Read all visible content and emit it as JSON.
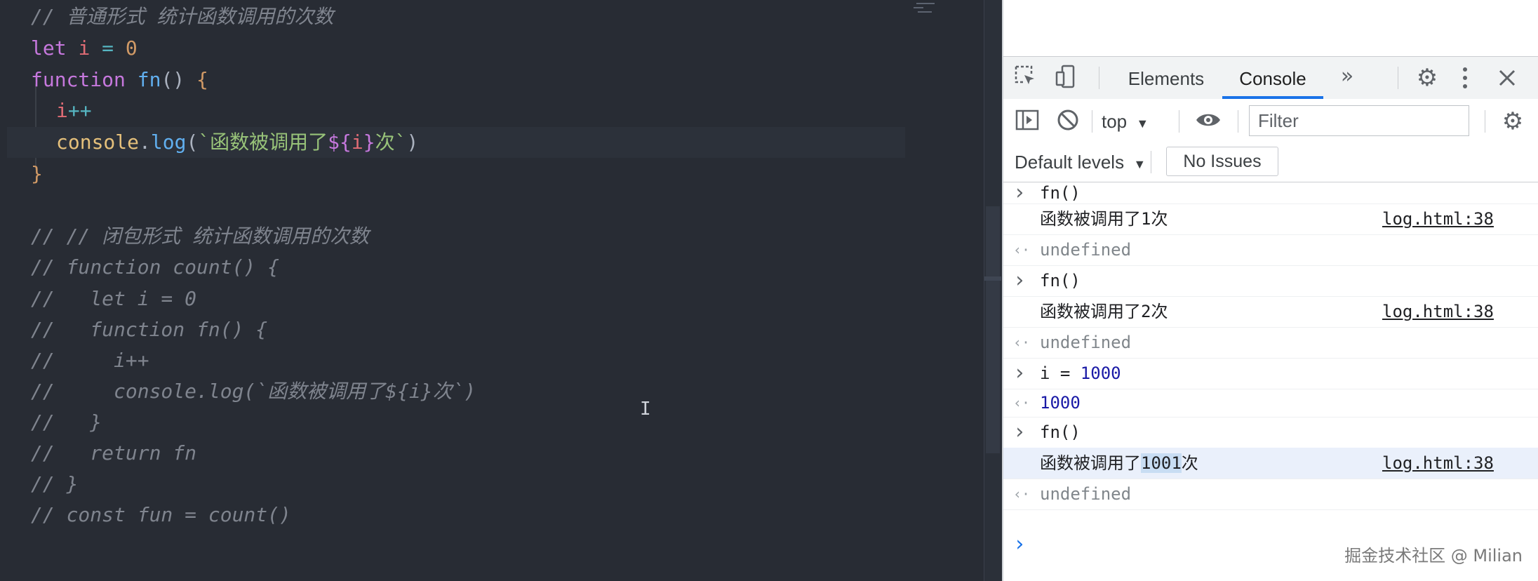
{
  "editor": {
    "lines": [
      [
        {
          "t": "// 普通形式 统计函数调用的次数",
          "c": "comment"
        }
      ],
      [
        {
          "t": "let",
          "c": "kw"
        },
        {
          "t": " ",
          "c": "punc"
        },
        {
          "t": "i",
          "c": "var"
        },
        {
          "t": " = ",
          "c": "op"
        },
        {
          "t": "0",
          "c": "num"
        }
      ],
      [
        {
          "t": "function",
          "c": "kw"
        },
        {
          "t": " ",
          "c": "punc"
        },
        {
          "t": "fn",
          "c": "fn"
        },
        {
          "t": "() ",
          "c": "punc"
        },
        {
          "t": "{",
          "c": "brace"
        }
      ],
      [
        {
          "t": "i",
          "c": "var"
        },
        {
          "t": "++",
          "c": "op"
        }
      ],
      [
        {
          "t": "console",
          "c": "obj"
        },
        {
          "t": ".",
          "c": "punc"
        },
        {
          "t": "log",
          "c": "fn"
        },
        {
          "t": "(",
          "c": "punc"
        },
        {
          "t": "`函数被调用了",
          "c": "str"
        },
        {
          "t": "${",
          "c": "interp"
        },
        {
          "t": "i",
          "c": "var"
        },
        {
          "t": "}",
          "c": "interp"
        },
        {
          "t": "次`",
          "c": "str"
        },
        {
          "t": ")",
          "c": "punc"
        }
      ],
      [
        {
          "t": "}",
          "c": "brace"
        }
      ],
      [],
      [
        {
          "t": "// // 闭包形式 统计函数调用的次数",
          "c": "comment"
        }
      ],
      [
        {
          "t": "// function count() {",
          "c": "comment"
        }
      ],
      [
        {
          "t": "//   let i = 0",
          "c": "comment"
        }
      ],
      [
        {
          "t": "//   function fn() {",
          "c": "comment"
        }
      ],
      [
        {
          "t": "//     i++",
          "c": "comment"
        }
      ],
      [
        {
          "t": "//     console.log(`函数被调用了${i}次`)",
          "c": "comment"
        }
      ],
      [
        {
          "t": "//   }",
          "c": "comment"
        }
      ],
      [
        {
          "t": "//   return fn",
          "c": "comment"
        }
      ],
      [
        {
          "t": "// }",
          "c": "comment"
        }
      ],
      [
        {
          "t": "// const fun = count()",
          "c": "comment"
        }
      ]
    ]
  },
  "devtools": {
    "tabs": [
      "Elements",
      "Console"
    ],
    "active_tab": "Console",
    "context": "top",
    "filter_placeholder": "Filter",
    "levels": "Default levels",
    "issues": "No Issues",
    "console": [
      {
        "type": "input",
        "text": "fn()"
      },
      {
        "type": "log",
        "text": "函数被调用了1次",
        "source": "log.html:38"
      },
      {
        "type": "return",
        "text": "undefined"
      },
      {
        "type": "input",
        "text": "fn()"
      },
      {
        "type": "log",
        "text": "函数被调用了2次",
        "source": "log.html:38"
      },
      {
        "type": "return",
        "text": "undefined"
      },
      {
        "type": "input",
        "text": "i = ",
        "num": "1000"
      },
      {
        "type": "return",
        "text": "",
        "num": "1000"
      },
      {
        "type": "input",
        "text": "fn()"
      },
      {
        "type": "log",
        "text": "函数被调用了",
        "selected": "1001",
        "after": "次",
        "source": "log.html:38"
      },
      {
        "type": "return",
        "text": "undefined"
      }
    ]
  },
  "watermark": "掘金技术社区 @ Milian",
  "icons": {
    "inspect": "inspect-element-icon",
    "device": "device-toggle-icon",
    "more_tabs": "more-tabs-icon",
    "settings": "gear-icon",
    "menu": "kebab-menu-icon",
    "close": "close-icon",
    "sidebar": "sidebar-toggle-icon",
    "clear": "clear-console-icon",
    "eye": "eye-icon"
  }
}
